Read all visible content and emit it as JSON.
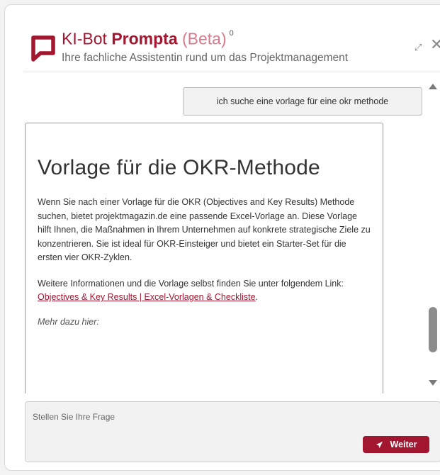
{
  "header": {
    "title_part1": "KI-Bot ",
    "title_part2": "Prompta",
    "title_part3": " (Beta)",
    "title_marker": "0",
    "subtitle": "Ihre fachliche Assistentin rund um das Projektmanagement",
    "expand_icon": "expand-icon",
    "close_icon": "close-icon",
    "brand_color": "#a3162f"
  },
  "chat": {
    "user_message": "ich suche eine vorlage für eine okr methode",
    "bot_message": {
      "heading": "Vorlage für die OKR-Methode",
      "paragraph1": "Wenn Sie nach einer Vorlage für die OKR (Objectives and Key Results) Methode suchen, bietet projektmagazin.de eine passende Excel-Vorlage an. Diese Vorlage hilft Ihnen, die Maßnahmen in Ihrem Unternehmen auf konkrete strategische Ziele zu konzentrieren. Sie ist ideal für OKR-Einsteiger und bietet ein Starter-Set für die ersten vier OKR-Zyklen.",
      "paragraph2_text": "Weitere Informationen und die Vorlage selbst finden Sie unter folgendem Link: ",
      "paragraph2_link": "Objectives & Key Results | Excel-Vorlagen & Checkliste",
      "paragraph2_end": ".",
      "paragraph3": "Mehr dazu hier:"
    }
  },
  "input": {
    "placeholder": "Stellen Sie Ihre Frage",
    "send_label": "Weiter",
    "send_icon": "send-icon"
  }
}
